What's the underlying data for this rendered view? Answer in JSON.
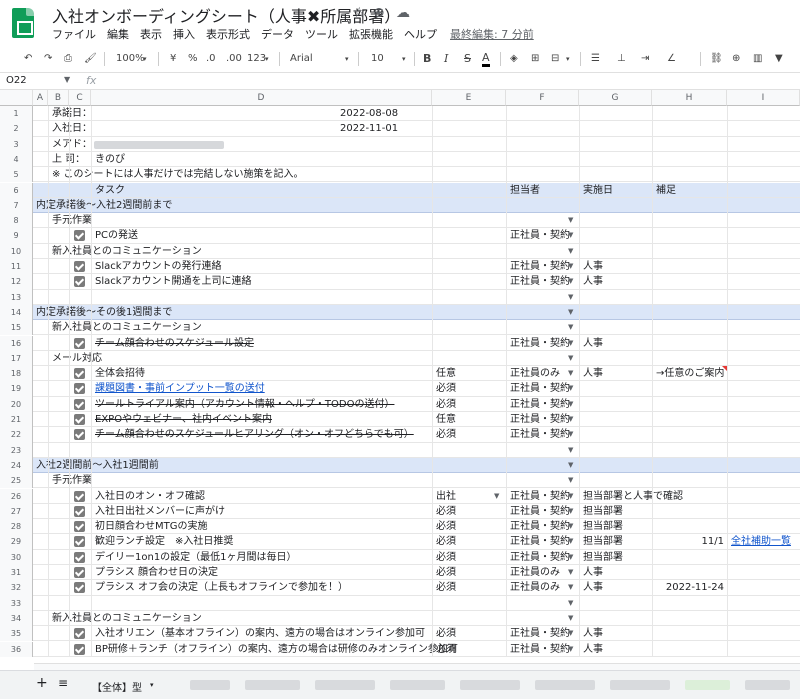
{
  "title": "入社オンボーディングシート（人事✖︎所属部署）",
  "title_icons": [
    "star-icon",
    "move-to-folder-icon",
    "cloud-status-icon"
  ],
  "menu": [
    "ファイル",
    "編集",
    "表示",
    "挿入",
    "表示形式",
    "データ",
    "ツール",
    "拡張機能",
    "ヘルプ"
  ],
  "last_edit": "最終編集: 7 分前",
  "toolbar": {
    "zoom": "100%",
    "currency": "¥",
    "percent": "%",
    "dec_decrease": ".0",
    "dec_increase": ".00",
    "more_formats": "123",
    "font": "Arial",
    "font_size": "10",
    "bold": "B",
    "italic": "I",
    "strike": "S",
    "text_color": "A"
  },
  "name_box": "O22",
  "fx": "fx",
  "columns": [
    "A",
    "B",
    "C",
    "D",
    "E",
    "F",
    "G",
    "H",
    "I"
  ],
  "rows": [
    {
      "n": "1",
      "type": "meta",
      "label": "承諾日：",
      "value": "2022-08-08"
    },
    {
      "n": "2",
      "type": "meta",
      "label": "入社日：",
      "value": "2022-11-01"
    },
    {
      "n": "3",
      "type": "meta-blur",
      "label": "メアド："
    },
    {
      "n": "4",
      "type": "meta-text",
      "label": "上 司：",
      "text": "きのぴ"
    },
    {
      "n": "5",
      "type": "note",
      "text": "※ このシートには人事だけでは完結しない施策を記入。"
    },
    {
      "n": "6",
      "type": "header",
      "task": "タスク",
      "owner": "担当者",
      "date": "実施日",
      "note": "補足"
    },
    {
      "n": "7",
      "type": "section",
      "text": "内定承諾後〜入社2週間前まで"
    },
    {
      "n": "8",
      "type": "group",
      "text": "手元作業",
      "dd": true
    },
    {
      "n": "9",
      "type": "item",
      "task": "PCの発送",
      "owner": "正社員・契約",
      "dd": true
    },
    {
      "n": "10",
      "type": "group",
      "text": "新入社員とのコミュニケーション",
      "dd": true
    },
    {
      "n": "11",
      "type": "item",
      "task": "Slackアカウントの発行連絡",
      "owner": "正社員・契約",
      "g": "人事",
      "dd": true
    },
    {
      "n": "12",
      "type": "item",
      "task": "Slackアカウント開通を上司に連絡",
      "owner": "正社員・契約",
      "g": "人事",
      "dd": true
    },
    {
      "n": "13",
      "type": "empty",
      "dd": true
    },
    {
      "n": "14",
      "type": "section",
      "text": "内定承諾後〜その後1週間まで",
      "dd": true
    },
    {
      "n": "15",
      "type": "group",
      "text": "新入社員とのコミュニケーション",
      "dd": true
    },
    {
      "n": "16",
      "type": "item",
      "task": "チーム顔合わせのスケジュール設定",
      "owner": "正社員・契約",
      "g": "人事",
      "dd": true,
      "strike": true
    },
    {
      "n": "17",
      "type": "group",
      "text": "メール対応",
      "dd": true
    },
    {
      "n": "18",
      "type": "item",
      "task": "全体会招待",
      "e": "任意",
      "owner": "正社員のみ",
      "g": "人事",
      "h": "→任意のご案内",
      "dd": true,
      "red": true
    },
    {
      "n": "19",
      "type": "item",
      "task": "課題図書・事前インプット一覧の送付",
      "e": "必須",
      "owner": "正社員・契約",
      "dd": true,
      "link": true
    },
    {
      "n": "20",
      "type": "item",
      "task": "ツールトライアル案内（アカウント情報・ヘルプ・TODOの送付）",
      "e": "必須",
      "owner": "正社員・契約",
      "dd": true,
      "strike": true
    },
    {
      "n": "21",
      "type": "item",
      "task": "EXPOやウェビナー、社内イベント案内",
      "e": "任意",
      "owner": "正社員・契約",
      "dd": true,
      "strike": true
    },
    {
      "n": "22",
      "type": "item",
      "task": "チーム顔合わせのスケジュールヒアリング（オン・オフどちらでも可）",
      "e": "必須",
      "owner": "正社員・契約",
      "dd": true,
      "strike": true
    },
    {
      "n": "23",
      "type": "empty",
      "dd": true
    },
    {
      "n": "24",
      "type": "section",
      "text": "入社2週間前〜入社1週間前",
      "dd": true
    },
    {
      "n": "25",
      "type": "group",
      "text": "手元作業",
      "dd": true
    },
    {
      "n": "26",
      "type": "item",
      "task": "入社日のオン・オフ確認",
      "e": "出社",
      "owner": "正社員・契約",
      "g": "担当部署と人事で確認",
      "dd": true,
      "edd": true
    },
    {
      "n": "27",
      "type": "item",
      "task": "入社日出社メンバーに声がけ",
      "e": "必須",
      "owner": "正社員・契約",
      "g": "担当部署",
      "dd": true
    },
    {
      "n": "28",
      "type": "item",
      "task": "初日顔合わせMTGの実施",
      "e": "必須",
      "owner": "正社員・契約",
      "g": "担当部署",
      "dd": true
    },
    {
      "n": "29",
      "type": "item",
      "task": "歓迎ランチ設定　※入社日推奨",
      "e": "必須",
      "owner": "正社員・契約",
      "g": "担当部署",
      "h": "11/1",
      "i": "全社補助一覧",
      "dd": true
    },
    {
      "n": "30",
      "type": "item",
      "task": "デイリー1on1の設定（最低1ヶ月間は毎日）",
      "e": "必須",
      "owner": "正社員・契約",
      "g": "担当部署",
      "dd": true
    },
    {
      "n": "31",
      "type": "item",
      "task": "プラシス 顔合わせ日の決定",
      "e": "必須",
      "owner": "正社員のみ",
      "g": "人事",
      "dd": true
    },
    {
      "n": "32",
      "type": "item",
      "task": "プラシス オフ会の決定（上長もオフラインで参加を！）",
      "e": "必須",
      "owner": "正社員のみ",
      "g": "人事",
      "h": "2022-11-24",
      "dd": true
    },
    {
      "n": "33",
      "type": "empty",
      "dd": true
    },
    {
      "n": "34",
      "type": "group",
      "text": "新入社員とのコミュニケーション",
      "dd": true
    },
    {
      "n": "35",
      "type": "item",
      "task": "入社オリエン（基本オフライン）の案内、遠方の場合はオンライン参加可",
      "e": "必須",
      "owner": "正社員・契約",
      "g": "人事",
      "dd": true
    },
    {
      "n": "36",
      "type": "item",
      "task": "BP研修＋ランチ（オフライン）の案内、遠方の場合は研修のみオンライン参加可",
      "e": "必須",
      "owner": "正社員・契約",
      "g": "人事",
      "dd": true
    }
  ],
  "sheet_tab": "【全体】型",
  "sheetbar_icons": [
    "add-sheet-icon",
    "all-sheets-icon"
  ]
}
